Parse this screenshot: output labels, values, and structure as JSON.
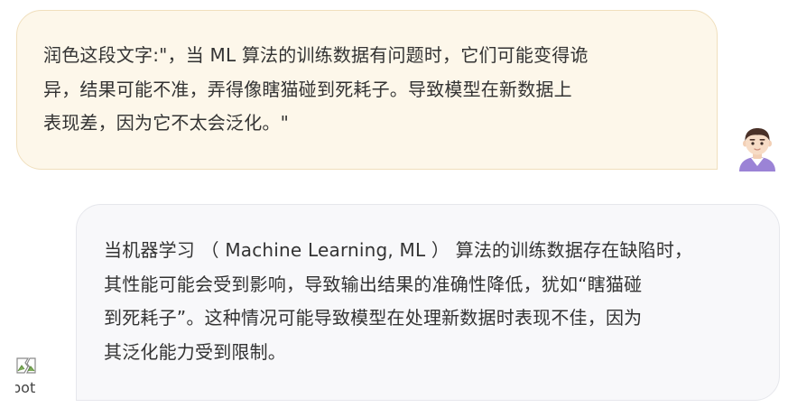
{
  "conversation": {
    "user_message": {
      "text": "润色这段文字:\"，当 ML 算法的训练数据有问题时，它们可能变得诡\n异，结果可能不准，弄得像瞎猫碰到死耗子。导致模型在新数据上\n表现差，因为它不太会泛化。\"",
      "avatar_icon": "user-avatar-icon"
    },
    "bot_message": {
      "text": "当机器学习 （ Machine Learning, ML ） 算法的训练数据存在缺陷时，\n其性能可能会受到影响，导致输出结果的准确性降低，犹如“瞎猫碰\n到死耗子”。这种情况可能导致模型在处理新数据时表现不佳，因为\n其泛化能力受到限制。",
      "avatar_alt": "bot",
      "avatar_icon": "broken-image-icon"
    }
  },
  "colors": {
    "user_bubble_bg": "#fdf7ea",
    "user_bubble_border": "#f0dfbd",
    "bot_bubble_bg": "#f8f8fa",
    "bot_bubble_border": "#e6e7ec",
    "text": "#333333"
  }
}
